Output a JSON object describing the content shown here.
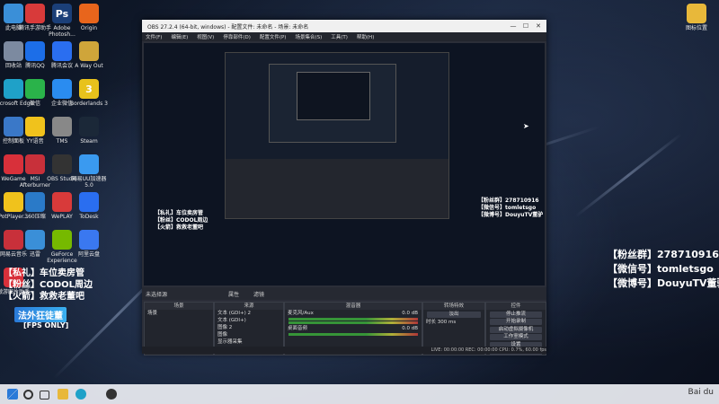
{
  "desktop_icons_left": [
    {
      "label": "此电脑",
      "color": "#3a8fd8"
    },
    {
      "label": "腾讯手游助手",
      "color": "#d83a3a"
    },
    {
      "label": "Adobe Photosh...",
      "color": "#1b3f78",
      "glyph": "Ps"
    },
    {
      "label": "Origin",
      "color": "#e8651c"
    },
    {
      "label": "回收站",
      "color": "#7c8aa0"
    },
    {
      "label": "腾讯QQ",
      "color": "#1c6ee8"
    },
    {
      "label": "腾讯会议",
      "color": "#2a6ef0"
    },
    {
      "label": "A Way Out",
      "color": "#cfa53a"
    },
    {
      "label": "Microsoft Edge",
      "color": "#1fa1c8"
    },
    {
      "label": "微信",
      "color": "#2ab34a"
    },
    {
      "label": "企业微信",
      "color": "#2a8cf0"
    },
    {
      "label": "Borderlands 3",
      "color": "#e8c21c",
      "glyph": "3"
    },
    {
      "label": "控制面板",
      "color": "#3a78c8"
    },
    {
      "label": "YY语音",
      "color": "#f0c21c"
    },
    {
      "label": "TMS",
      "color": "#888888"
    },
    {
      "label": "Steam",
      "color": "#1b2838"
    },
    {
      "label": "WeGame",
      "color": "#d8303a"
    },
    {
      "label": "MSI Afterburner",
      "color": "#c8303a"
    },
    {
      "label": "OBS Studio",
      "color": "#333333"
    },
    {
      "label": "网易UU加速器5.0",
      "color": "#3a9af0"
    },
    {
      "label": "PotPlayer...",
      "color": "#f0c21c"
    },
    {
      "label": "360压缩",
      "color": "#2a7ac8"
    },
    {
      "label": "WePLAY",
      "color": "#d83a3a"
    },
    {
      "label": "ToDesk",
      "color": "#2a6ef0"
    },
    {
      "label": "网易云音乐",
      "color": "#c8303a"
    },
    {
      "label": "迅雷",
      "color": "#3a8fd8"
    },
    {
      "label": "GeForce Experience",
      "color": "#76b900"
    },
    {
      "label": "阿里云盘",
      "color": "#3a78f0"
    },
    {
      "label": "傲游图片助手",
      "color": "#d8303a"
    }
  ],
  "desktop_icon_right": {
    "label": "图标位置",
    "color": "#e8b83a"
  },
  "obs": {
    "title": "OBS 27.2.4 (64-bit, windows) - 配置文件: 未命名 - 场景: 未命名",
    "menu": [
      "文件(F)",
      "编辑(E)",
      "视图(V)",
      "停靠部件(D)",
      "配置文件(P)",
      "场景集合(S)",
      "工具(T)",
      "帮助(H)"
    ],
    "dock_label": "未选择源",
    "dock_buttons": [
      "属性",
      "滤镜"
    ],
    "panels": {
      "scenes": {
        "header": "场景",
        "items": [
          "场景"
        ]
      },
      "sources": {
        "header": "来源",
        "items": [
          "文本 (GDI+) 2",
          "文本 (GDI+)",
          "图像 2",
          "图像",
          "显示器采集"
        ]
      },
      "mixer": {
        "header": "混音器",
        "channels": [
          {
            "name": "麦克风/Aux",
            "db": "0.0 dB"
          },
          {
            "name": "桌面音频",
            "db": "0.0 dB"
          }
        ]
      },
      "transitions": {
        "header": "转场特效",
        "type": "淡出",
        "duration_label": "时长",
        "duration": "300 ms"
      },
      "controls": {
        "header": "控件",
        "buttons": [
          "停止推流",
          "开始录制",
          "启动虚拟摄像机",
          "工作室模式",
          "设置",
          "退出"
        ]
      }
    },
    "status": "LIVE: 00:00:00   REC: 00:00:00   CPU: 0.7%, 60.00 fps"
  },
  "overlay_right": [
    "【粉丝群】278710916",
    "【微信号】tomletsgo",
    "【微博号】DouyuTV董驴"
  ],
  "overlay_left": [
    "【私礼】车位卖房管",
    "【粉丝】CODOL周边",
    "【火箭】救救老董吧",
    "法外狂徒董",
    "[FPS ONLY]"
  ],
  "taskbar": {
    "icons": [
      "windows-icon",
      "search-icon",
      "taskview-icon",
      "explorer-icon",
      "edge-icon",
      "obs-icon"
    ],
    "watermark": "Bai du"
  }
}
